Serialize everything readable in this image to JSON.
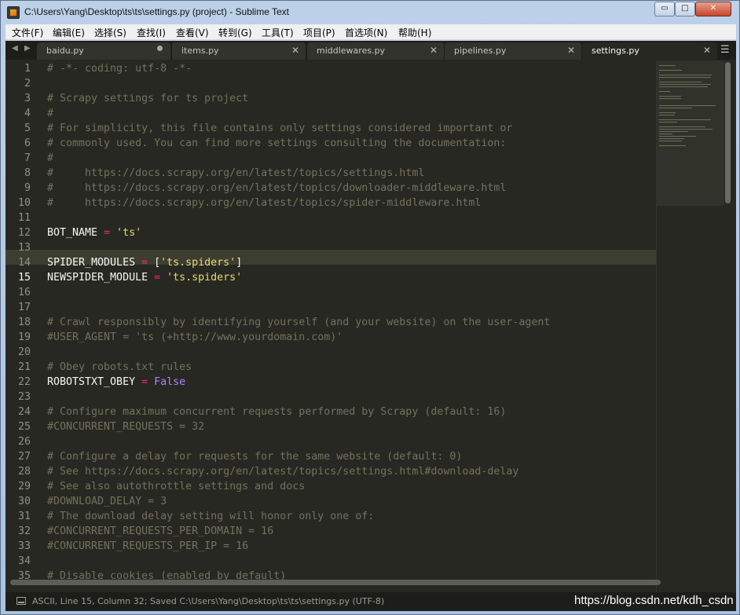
{
  "window": {
    "title": "C:\\Users\\Yang\\Desktop\\ts\\ts\\settings.py (project) - Sublime Text",
    "min_label": "▭",
    "max_label": "□",
    "close_label": "✕"
  },
  "menu": [
    "文件(F)",
    "编辑(E)",
    "选择(S)",
    "查找(I)",
    "查看(V)",
    "转到(G)",
    "工具(T)",
    "项目(P)",
    "首选项(N)",
    "帮助(H)"
  ],
  "tabs": [
    {
      "label": "baidu.py",
      "dirty": true
    },
    {
      "label": "items.py"
    },
    {
      "label": "middlewares.py"
    },
    {
      "label": "pipelines.py"
    },
    {
      "label": "settings.py",
      "active": true
    }
  ],
  "editor": {
    "current_line": 15,
    "lines": [
      [
        [
          "c-com",
          "# -*- coding: utf-8 -*-"
        ]
      ],
      [],
      [
        [
          "c-com",
          "# Scrapy settings for ts project"
        ]
      ],
      [
        [
          "c-com",
          "#"
        ]
      ],
      [
        [
          "c-com",
          "# For simplicity, this file contains only settings considered important or"
        ]
      ],
      [
        [
          "c-com",
          "# commonly used. You can find more settings consulting the documentation:"
        ]
      ],
      [
        [
          "c-com",
          "#"
        ]
      ],
      [
        [
          "c-com",
          "#     https://docs.scrapy.org/en/latest/topics/settings.html"
        ]
      ],
      [
        [
          "c-com",
          "#     https://docs.scrapy.org/en/latest/topics/downloader-middleware.html"
        ]
      ],
      [
        [
          "c-com",
          "#     https://docs.scrapy.org/en/latest/topics/spider-middleware.html"
        ]
      ],
      [],
      [
        [
          "",
          "BOT_NAME "
        ],
        [
          "c-op",
          "="
        ],
        [
          "",
          " "
        ],
        [
          "c-str",
          "'ts'"
        ]
      ],
      [],
      [
        [
          "",
          "SPIDER_MODULES "
        ],
        [
          "c-op",
          "="
        ],
        [
          "",
          " ["
        ],
        [
          "c-str",
          "'ts.spiders'"
        ],
        [
          "",
          "]"
        ]
      ],
      [
        [
          "",
          "NEWSPIDER_MODULE "
        ],
        [
          "c-op",
          "="
        ],
        [
          "",
          " "
        ],
        [
          "c-str",
          "'ts.spiders'"
        ]
      ],
      [],
      [],
      [
        [
          "c-com",
          "# Crawl responsibly by identifying yourself (and your website) on the user-agent"
        ]
      ],
      [
        [
          "c-com",
          "#USER_AGENT = 'ts (+http://www.yourdomain.com)'"
        ]
      ],
      [],
      [
        [
          "c-com",
          "# Obey robots.txt rules"
        ]
      ],
      [
        [
          "",
          "ROBOTSTXT_OBEY "
        ],
        [
          "c-op",
          "="
        ],
        [
          "",
          " "
        ],
        [
          "c-con",
          "False"
        ]
      ],
      [],
      [
        [
          "c-com",
          "# Configure maximum concurrent requests performed by Scrapy (default: 16)"
        ]
      ],
      [
        [
          "c-com",
          "#CONCURRENT_REQUESTS = 32"
        ]
      ],
      [],
      [
        [
          "c-com",
          "# Configure a delay for requests for the same website (default: 0)"
        ]
      ],
      [
        [
          "c-com",
          "# See https://docs.scrapy.org/en/latest/topics/settings.html#download-delay"
        ]
      ],
      [
        [
          "c-com",
          "# See also autothrottle settings and docs"
        ]
      ],
      [
        [
          "c-com",
          "#DOWNLOAD_DELAY = 3"
        ]
      ],
      [
        [
          "c-com",
          "# The download delay setting will honor only one of:"
        ]
      ],
      [
        [
          "c-com",
          "#CONCURRENT_REQUESTS_PER_DOMAIN = 16"
        ]
      ],
      [
        [
          "c-com",
          "#CONCURRENT_REQUESTS_PER_IP = 16"
        ]
      ],
      [],
      [
        [
          "c-com",
          "# Disable cookies (enabled by default)"
        ]
      ]
    ]
  },
  "status": {
    "text": "ASCII, Line 15, Column 32; Saved C:\\Users\\Yang\\Desktop\\ts\\ts\\settings.py (UTF-8)",
    "watermark": "https://blog.csdn.net/kdh_csdn"
  }
}
